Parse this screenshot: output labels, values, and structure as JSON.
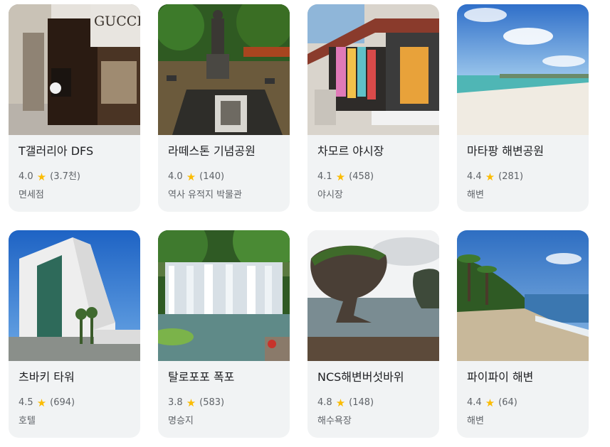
{
  "places": [
    {
      "name": "T갤러리아 DFS",
      "rating": "4.0",
      "reviews": "(3.7천)",
      "category": "면세점",
      "image_icon": "gucci-store-photo"
    },
    {
      "name": "라떼스톤 기념공원",
      "rating": "4.0",
      "reviews": "(140)",
      "category": "역사 유적지 박물관",
      "image_icon": "statue-park-photo"
    },
    {
      "name": "차모르 야시장",
      "rating": "4.1",
      "reviews": "(458)",
      "category": "야시장",
      "image_icon": "market-stall-photo"
    },
    {
      "name": "마타팡 해변공원",
      "rating": "4.4",
      "reviews": "(281)",
      "category": "해변",
      "image_icon": "beach-photo"
    },
    {
      "name": "츠바키 타워",
      "rating": "4.5",
      "reviews": "(694)",
      "category": "호텔",
      "image_icon": "hotel-tower-photo"
    },
    {
      "name": "탈로포포 폭포",
      "rating": "3.8",
      "reviews": "(583)",
      "category": "명승지",
      "image_icon": "waterfall-photo"
    },
    {
      "name": "NCS해변버섯바위",
      "rating": "4.8",
      "reviews": "(148)",
      "category": "해수욕장",
      "image_icon": "mushroom-rock-photo"
    },
    {
      "name": "파이파이 해변",
      "rating": "4.4",
      "reviews": "(64)",
      "category": "해변",
      "image_icon": "palm-beach-photo"
    }
  ],
  "star_glyph": "★",
  "star_color": "#fbbc04",
  "photo_text": {
    "gucci_sign": "GUCCI"
  }
}
